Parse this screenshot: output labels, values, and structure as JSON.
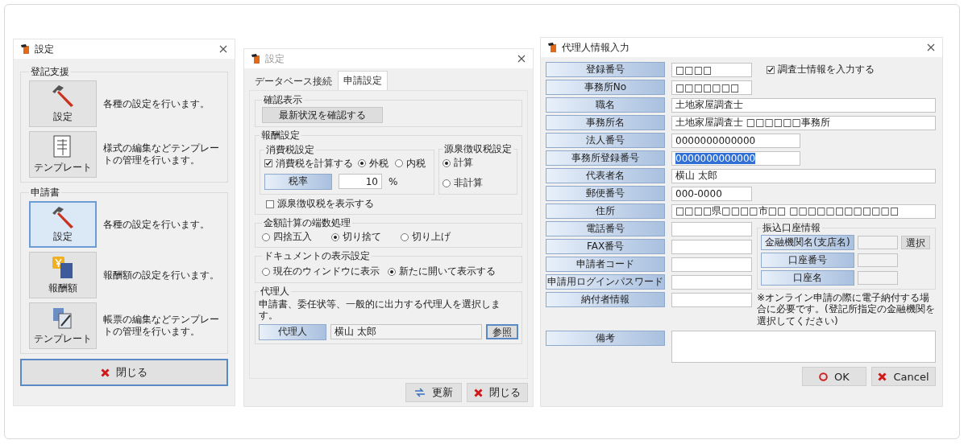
{
  "menu_window": {
    "title": "設定",
    "groups": [
      {
        "label": "登記支援",
        "items": [
          {
            "label": "設定",
            "description": "各種の設定を行います。",
            "selected": false
          },
          {
            "label": "テンプレート",
            "description": "様式の編集などテンプレートの管理を行います。",
            "selected": false
          }
        ]
      },
      {
        "label": "申請書",
        "items": [
          {
            "label": "設定",
            "description": "各種の設定を行います。",
            "selected": true
          },
          {
            "label": "報酬額",
            "description": "報酬額の設定を行います。",
            "selected": false
          },
          {
            "label": "テンプレート",
            "description": "帳票の編集などテンプレートの管理を行います。",
            "selected": false
          }
        ]
      }
    ],
    "close_button": "閉じる"
  },
  "settings_window": {
    "title": "設定",
    "tabs": [
      {
        "label": "データベース接続",
        "selected": false
      },
      {
        "label": "申請設定",
        "selected": true
      }
    ],
    "confirm": {
      "label": "確認表示",
      "button": "最新状況を確認する"
    },
    "fee": {
      "label": "報酬設定",
      "tax": {
        "label": "消費税設定",
        "checkbox": {
          "label": "消費税を計算する",
          "checked": true
        },
        "radios": [
          {
            "label": "外税",
            "selected": true
          },
          {
            "label": "内税",
            "selected": false
          }
        ],
        "rate_button": "税率",
        "rate_value": "10",
        "rate_unit": "%"
      },
      "withholding": {
        "label": "源泉徴収税設定",
        "radios": [
          {
            "label": "計算",
            "selected": true
          },
          {
            "label": "非計算",
            "selected": false
          }
        ]
      },
      "show_checkbox": {
        "label": "源泉徴収税を表示する",
        "checked": false
      }
    },
    "rounding": {
      "label": "金額計算の端数処理",
      "radios": [
        {
          "label": "四捨五入",
          "selected": false
        },
        {
          "label": "切り捨て",
          "selected": true
        },
        {
          "label": "切り上げ",
          "selected": false
        }
      ]
    },
    "display": {
      "label": "ドキュメントの表示設定",
      "radios": [
        {
          "label": "現在のウィンドウに表示",
          "selected": false
        },
        {
          "label": "新たに開いて表示する",
          "selected": true
        }
      ]
    },
    "agent": {
      "label": "代理人",
      "text": "申請書、委任状等、一般的に出力する代理人を選択します。",
      "button": "代理人",
      "value": "横山 太郎",
      "browse": "参照"
    },
    "buttons": [
      {
        "label": "更新"
      },
      {
        "label": "閉じる"
      }
    ]
  },
  "agent_window": {
    "title": "代理人情報入力",
    "checkbox": {
      "label": "調査士情報を入力する",
      "checked": true
    },
    "rows": [
      {
        "label": "登録番号",
        "value": "□□□□",
        "kind": "short",
        "highlighted": false
      },
      {
        "label": "事務所No",
        "value": "□□□□□□□",
        "kind": "short",
        "highlighted": false
      },
      {
        "label": "職名",
        "value": "土地家屋調査士",
        "kind": "wide",
        "highlighted": false
      },
      {
        "label": "事務所名",
        "value": "土地家屋調査士 □□□□□□事務所",
        "kind": "wide",
        "highlighted": false
      },
      {
        "label": "法人番号",
        "value": "0000000000000",
        "kind": "medium",
        "highlighted": false
      },
      {
        "label": "事務所登録番号",
        "value": "0000000000000",
        "kind": "medium",
        "highlighted": true
      },
      {
        "label": "代表者名",
        "value": "横山 太郎",
        "kind": "wide",
        "highlighted": false
      },
      {
        "label": "郵便番号",
        "value": "000-0000",
        "kind": "short",
        "highlighted": false
      },
      {
        "label": "住所",
        "value": "□□□□県□□□□市□□ □□□□□□□□□□□□",
        "kind": "wide",
        "highlighted": false
      }
    ],
    "contact_rows": [
      {
        "label": "電話番号"
      },
      {
        "label": "FAX番号"
      },
      {
        "label": "申請者コード"
      },
      {
        "label": "申請用ログインパスワード"
      },
      {
        "label": "納付者情報"
      }
    ],
    "bank": {
      "label": "振込口座情報",
      "rows": [
        {
          "label": "金融機関名(支店名)"
        },
        {
          "label": "口座番号"
        },
        {
          "label": "口座名"
        }
      ],
      "select_button": "選択"
    },
    "note": "※オンライン申請の際に電子納付する場合に必要です。(登記所指定の金融機関を選択してください)",
    "remarks": "備考",
    "buttons": [
      {
        "label": "OK"
      },
      {
        "label": "Cancel"
      }
    ]
  }
}
